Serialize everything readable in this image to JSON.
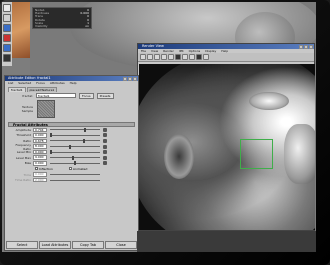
{
  "channel_box": {
    "rows": [
      {
        "key": "Node1",
        "value": "0"
      },
      {
        "key": "Hardness",
        "value": "0.000"
      },
      {
        "key": "Trans",
        "value": "0"
      },
      {
        "key": "Rotate",
        "value": "0"
      },
      {
        "key": "Scale",
        "value": "1"
      },
      {
        "key": "Visibility",
        "value": "on"
      }
    ]
  },
  "render_view": {
    "title": "Render View",
    "menu": [
      "File",
      "View",
      "Render",
      "IPR",
      "Options",
      "Display",
      "Help"
    ]
  },
  "attribute_editor": {
    "title": "Attribute Editor: fractal1",
    "menu": [
      "List",
      "Selected",
      "Focus",
      "Attributes",
      "Help"
    ],
    "tabs": [
      "fractal1",
      "place2dTexture1"
    ],
    "node_label": "fractal:",
    "node_value": "fractal1",
    "focus_button": "Focus",
    "presets_button": "Presets",
    "swatch_label": "Texture Sample",
    "section_title": "Fractal Attributes",
    "attributes": [
      {
        "label": "Amplitude",
        "value": "0.704",
        "pos": 0.7
      },
      {
        "label": "Threshold",
        "value": "0.000",
        "pos": 0.0
      },
      {
        "label": "Ratio",
        "value": "0.678",
        "pos": 0.68
      },
      {
        "label": "Frequency Ratio",
        "value": "8.000",
        "pos": 0.4
      },
      {
        "label": "Level Min",
        "value": "0.000",
        "pos": 0.0
      },
      {
        "label": "Level Max",
        "value": "9.000",
        "pos": 0.45
      },
      {
        "label": "Bias",
        "value": "0.000",
        "pos": 0.5
      }
    ],
    "checkboxes": [
      "Inflection",
      "Animated"
    ],
    "dim_attributes": [
      {
        "label": "Time",
        "value": "0.000"
      },
      {
        "label": "Time Ratio",
        "value": "2.000"
      }
    ],
    "footer": [
      "Select",
      "Load Attributes",
      "Copy Tab",
      "Close"
    ]
  }
}
